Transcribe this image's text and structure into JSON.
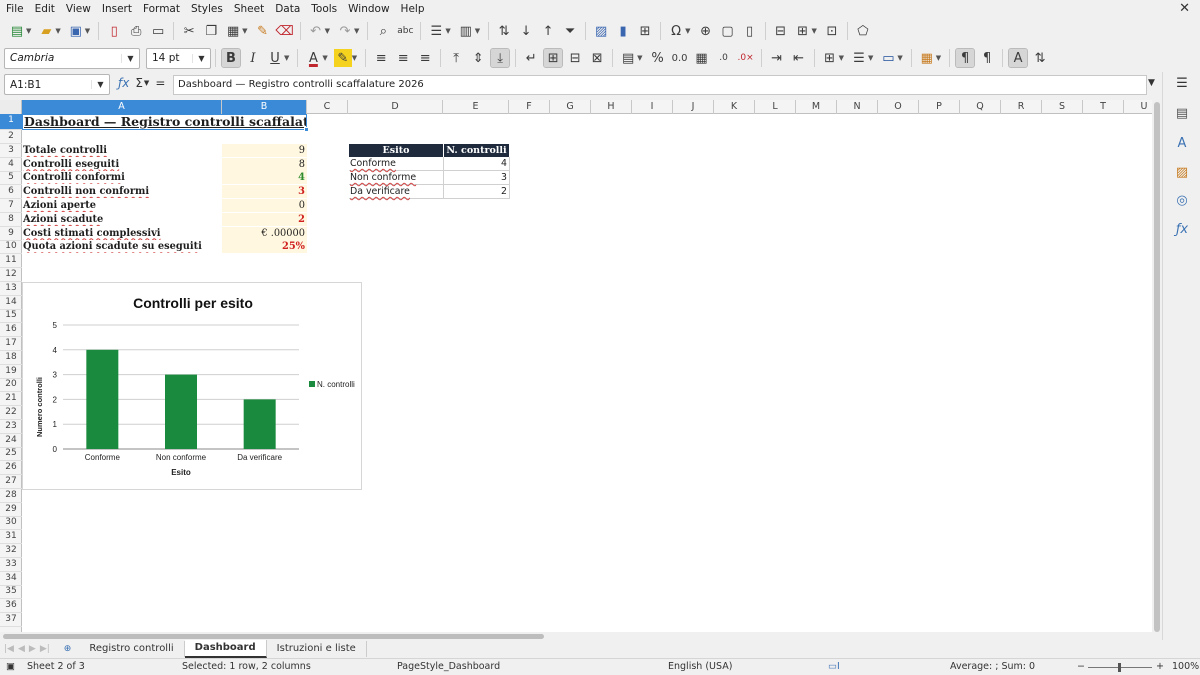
{
  "menu": [
    "File",
    "Edit",
    "View",
    "Insert",
    "Format",
    "Styles",
    "Sheet",
    "Data",
    "Tools",
    "Window",
    "Help"
  ],
  "formatting": {
    "font_name": "Cambria",
    "font_size": "14 pt",
    "font_color": "#c0262d",
    "highlight_color": "#f5d21e",
    "border_color": "#1e4f9b",
    "icons": [
      "bold-icon",
      "italic-icon",
      "underline-icon",
      "font-color-icon",
      "highlight-icon",
      "align-left-icon",
      "align-center-icon",
      "align-right-icon",
      "align-top-icon",
      "align-middle-icon",
      "align-bottom-icon",
      "wrap-text-icon",
      "merge-center-icon",
      "merge-icon",
      "unmerge-icon",
      "currency-icon",
      "percent-icon",
      "number-format-icon",
      "date-icon",
      "add-decimal-icon",
      "delete-decimal-icon",
      "increase-indent-icon",
      "decrease-indent-icon",
      "borders-icon",
      "border-style-icon",
      "border-color-icon",
      "conditional-icon",
      "ltr-icon",
      "rtl-icon",
      "text-direction-icon",
      "vertical-text-icon"
    ]
  },
  "formula_bar": {
    "cell_reference": "A1:B1",
    "content": "Dashboard — Registro controlli scaffalature 2026"
  },
  "columns": [
    "A",
    "B",
    "C",
    "D",
    "E",
    "F",
    "G",
    "H",
    "I",
    "J",
    "K",
    "L",
    "M",
    "N",
    "O",
    "P",
    "Q",
    "R",
    "S",
    "T",
    "U"
  ],
  "rows": [
    "1",
    "2",
    "3",
    "4",
    "5",
    "6",
    "7",
    "8",
    "9",
    "10",
    "11",
    "12",
    "13",
    "14",
    "15",
    "16",
    "17",
    "18",
    "19",
    "20",
    "21",
    "22",
    "23",
    "24",
    "25",
    "26",
    "27",
    "28",
    "29",
    "30",
    "31",
    "32",
    "33",
    "34",
    "35",
    "36",
    "37"
  ],
  "sheet": {
    "title": "Dashboard — Registro controlli scaffalature 2026",
    "kpis": [
      {
        "label": "Totale controlli",
        "value": "9",
        "style": "normal"
      },
      {
        "label": "Controlli eseguiti",
        "value": "8",
        "style": "normal"
      },
      {
        "label": "Controlli conformi",
        "value": "4",
        "style": "green"
      },
      {
        "label": "Controlli non conformi",
        "value": "3",
        "style": "red"
      },
      {
        "label": "Azioni aperte",
        "value": "0",
        "style": "normal"
      },
      {
        "label": "Azioni scadute",
        "value": "2",
        "style": "red"
      },
      {
        "label": "Costi stimati complessivi",
        "value": "€ .00000",
        "style": "normal"
      },
      {
        "label": "Quota azioni scadute su eseguiti",
        "value": "25%",
        "style": "red"
      }
    ],
    "esito_table": {
      "headers": [
        "Esito",
        "N. controlli"
      ],
      "rows": [
        {
          "esito": "Conforme",
          "count": "4"
        },
        {
          "esito": "Non conforme",
          "count": "3"
        },
        {
          "esito": "Da verificare",
          "count": "2"
        }
      ]
    }
  },
  "chart_data": {
    "type": "bar",
    "title": "Controlli per esito",
    "categories": [
      "Conforme",
      "Non conforme",
      "Da verificare"
    ],
    "series": [
      {
        "name": "N. controlli",
        "values": [
          4,
          3,
          2
        ],
        "color": "#1a8a3e"
      }
    ],
    "xlabel": "Esito",
    "ylabel": "Numero controlli",
    "ylim": [
      0,
      5
    ],
    "yticks": [
      "0",
      "1",
      "2",
      "3",
      "4",
      "5"
    ],
    "grid": true,
    "legend_position": "right"
  },
  "sheet_tabs": [
    "Registro controlli",
    "Dashboard",
    "Istruzioni e liste"
  ],
  "status": {
    "sheet": "Sheet 2 of 3",
    "selection": "Selected: 1 row, 2 columns",
    "page_style": "PageStyle_Dashboard",
    "language": "English (USA)",
    "sum": "Average: ; Sum: 0",
    "zoom": "100%"
  }
}
